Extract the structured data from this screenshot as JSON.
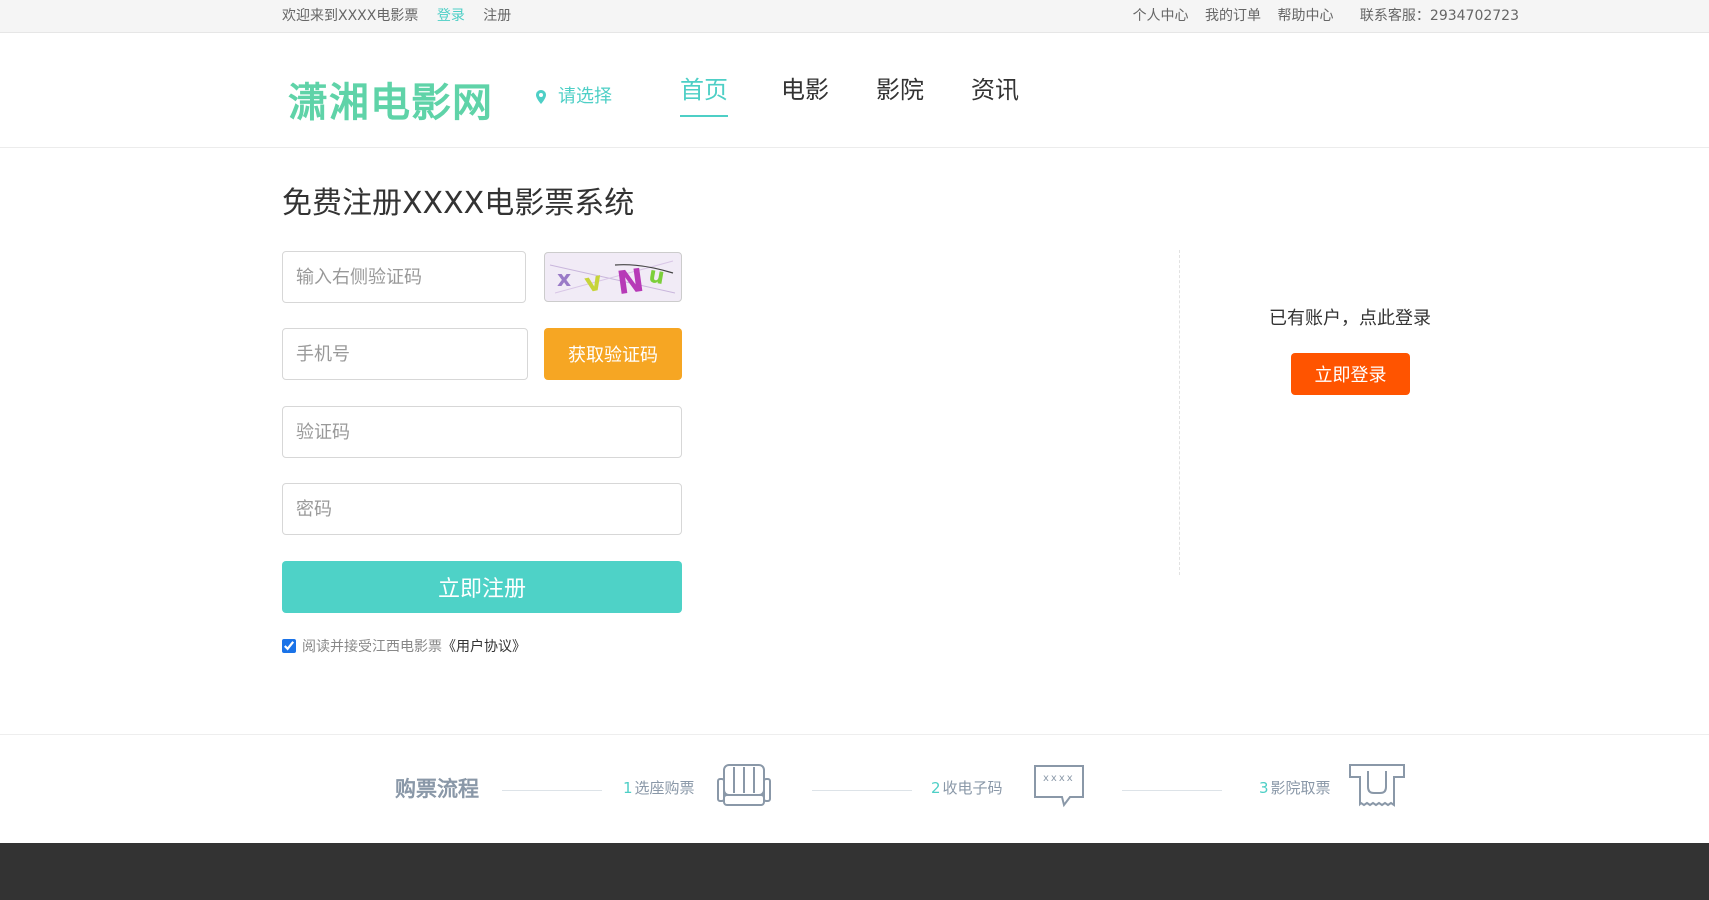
{
  "topbar": {
    "welcome": "欢迎来到XXXX电影票",
    "login": "登录",
    "register": "注册",
    "personal_center": "个人中心",
    "my_orders": "我的订单",
    "help_center": "帮助中心",
    "service": "联系客服：2934702723"
  },
  "header": {
    "logo": "潇湘电影网",
    "city_select": "请选择",
    "nav": [
      "首页",
      "电影",
      "影院",
      "资讯"
    ]
  },
  "form": {
    "title": "免费注册XXXX电影票系统",
    "captcha_placeholder": "输入右侧验证码",
    "captcha_text": "xvNu",
    "phone_placeholder": "手机号",
    "get_code_label": "获取验证码",
    "code_placeholder": "验证码",
    "password_placeholder": "密码",
    "submit_label": "立即注册",
    "agree_text": "阅读并接受江西电影票",
    "agreement_link": "《用户协议》",
    "agree_checked": true
  },
  "side": {
    "have_account": "已有账户，点此登录",
    "login_button": "立即登录"
  },
  "process": {
    "title": "购票流程",
    "steps": [
      {
        "num": "1",
        "label": "选座购票",
        "icon": "seat-icon"
      },
      {
        "num": "2",
        "label": "收电子码",
        "icon": "message-icon",
        "icon_text": "xxxx"
      },
      {
        "num": "3",
        "label": "影院取票",
        "icon": "ticket-machine-icon"
      }
    ]
  },
  "colors": {
    "accent": "#4ecfc6",
    "orange_button": "#f6a623",
    "login_button": "#ff5400",
    "logo": "#5fd3a8",
    "footer": "#333333"
  }
}
